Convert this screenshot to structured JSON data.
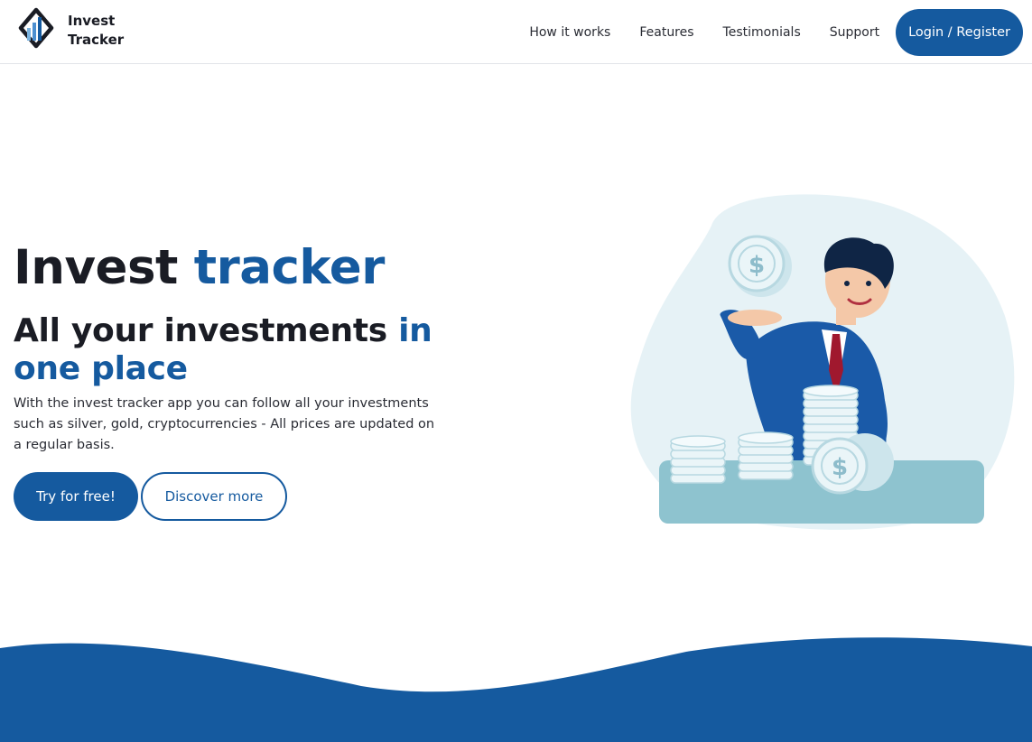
{
  "brand": {
    "name_line1": "Invest",
    "name_line2": "Tracker"
  },
  "nav": {
    "links": [
      "How it works",
      "Features",
      "Testimonials",
      "Support"
    ],
    "login_label": "Login / Register"
  },
  "hero": {
    "title_part1": "Invest",
    "title_part2": "tracker",
    "subtitle_part1": "All your investments",
    "subtitle_part2": "in one place",
    "description": "With the invest tracker app you can follow all your investments such as silver, gold, cryptocurrencies - All prices are updated on a regular basis.",
    "primary_cta": "Try for free!",
    "secondary_cta": "Discover more"
  },
  "illustration": {
    "coin_symbol": "$"
  },
  "colors": {
    "primary": "#155a9f",
    "text": "#1a1c24",
    "blob": "#e6f2f6",
    "coin": "#eaf5f8",
    "floor": "#8ec3cf"
  }
}
